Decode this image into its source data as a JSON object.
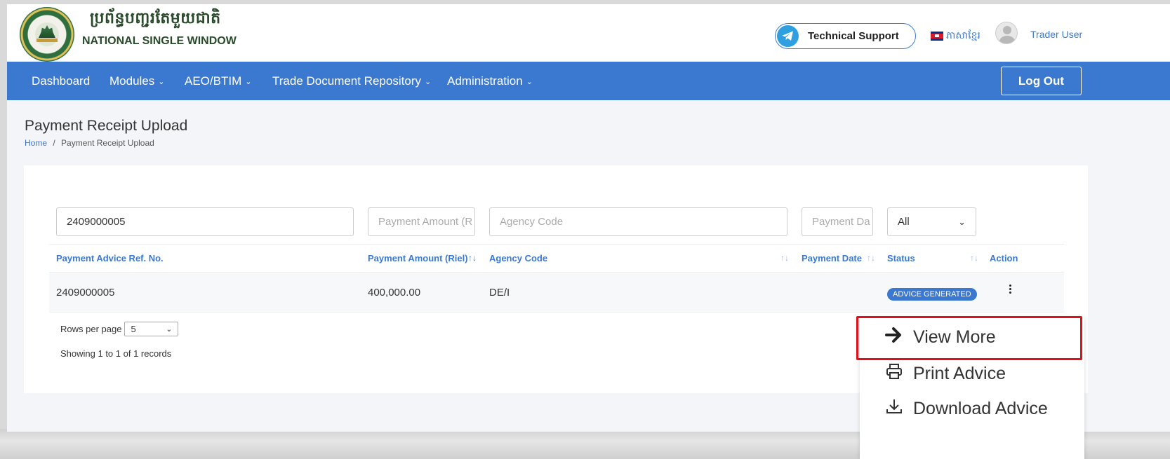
{
  "header": {
    "brand_kh": "ប្រព័ន្ធបញ្ជរតែមួយជាតិ",
    "brand_en": "NATIONAL SINGLE WINDOW",
    "support_label": "Technical Support",
    "language_label": "ភាសាខ្មែរ",
    "user_name": "Trader User"
  },
  "nav": {
    "items": [
      {
        "label": "Dashboard"
      },
      {
        "label": "Modules"
      },
      {
        "label": "AEO/BTIM"
      },
      {
        "label": "Trade Document Repository"
      },
      {
        "label": "Administration"
      }
    ],
    "logout_label": "Log Out"
  },
  "page": {
    "title": "Payment Receipt Upload",
    "breadcrumb_home": "Home",
    "breadcrumb_sep": "/",
    "breadcrumb_current": "Payment Receipt Upload"
  },
  "filters": {
    "ref_value": "2409000005",
    "amount_placeholder": "Payment Amount (R",
    "agency_placeholder": "Agency Code",
    "date_placeholder": "Payment Da",
    "status_value": "All"
  },
  "table": {
    "headers": [
      "Payment Advice Ref. No.",
      "Payment Amount (Riel)",
      "Agency Code",
      "Payment Date",
      "Status",
      "Action"
    ],
    "rows": [
      {
        "ref": "2409000005",
        "amount": "400,000.00",
        "agency": "DE/I",
        "date": "",
        "status": "ADVICE GENERATED"
      }
    ]
  },
  "pagination": {
    "rows_per_page_label": "Rows per page",
    "rows_per_page_value": "5",
    "showing_text": "Showing 1 to 1 of 1 records"
  },
  "action_menu": {
    "items": [
      {
        "label": "View More",
        "icon": "arrow-right-icon"
      },
      {
        "label": "Print Advice",
        "icon": "printer-icon"
      },
      {
        "label": "Download Advice",
        "icon": "download-icon"
      }
    ]
  },
  "colors": {
    "primary": "#3b78d0",
    "highlight": "#e0101a"
  }
}
